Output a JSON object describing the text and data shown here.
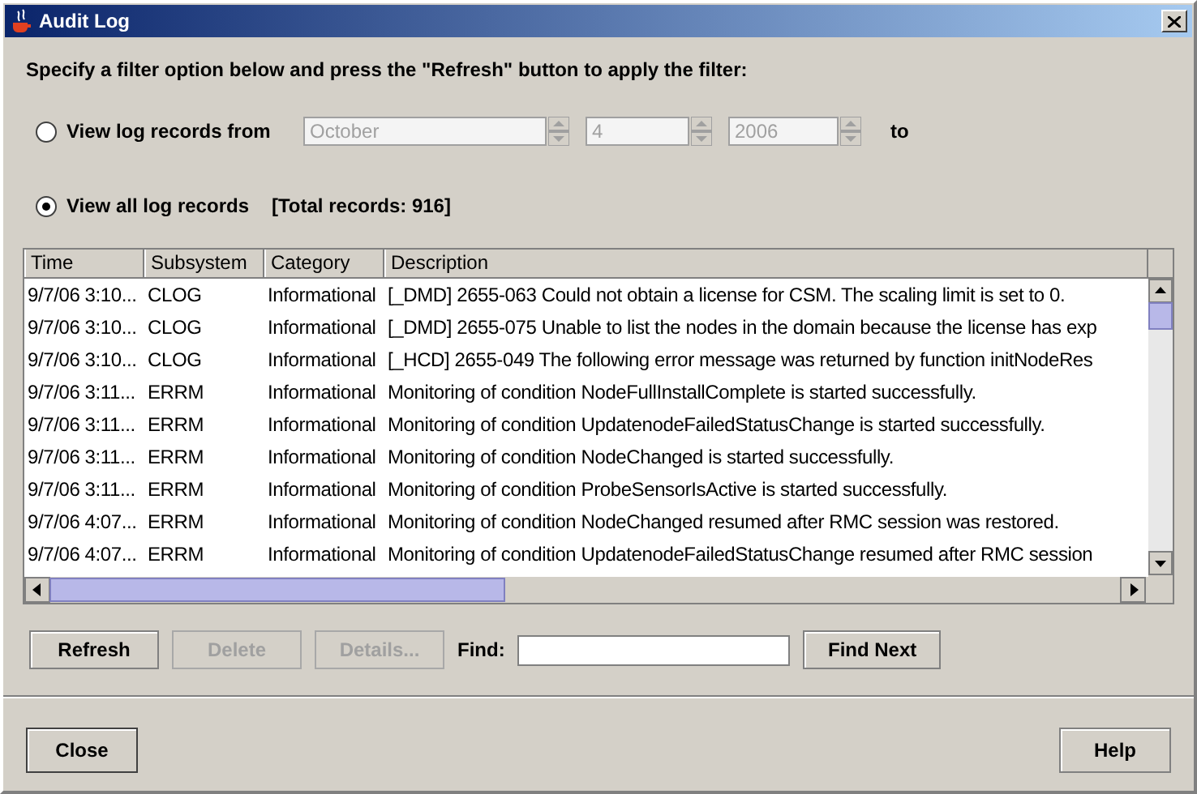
{
  "window": {
    "title": "Audit Log"
  },
  "instruction": "Specify a filter option below and press the \"Refresh\" button to apply the filter:",
  "filters": [
    {
      "label": "View log records from",
      "selected": false,
      "spinners": [
        {
          "value": "October",
          "disabled": true
        },
        {
          "value": "4",
          "disabled": true
        },
        {
          "value": "2006",
          "disabled": true
        }
      ],
      "suffix": "to"
    },
    {
      "label": "View all log records",
      "selected": true,
      "note": "[Total records: 916]"
    }
  ],
  "table": {
    "columns": [
      "Time",
      "Subsystem",
      "Category",
      "Description"
    ],
    "rows": [
      [
        "9/7/06 3:10...",
        "CLOG",
        "Informational",
        "[_DMD] 2655-063 Could not obtain a license for CSM. The scaling limit is set to 0."
      ],
      [
        "9/7/06 3:10...",
        "CLOG",
        "Informational",
        "[_DMD] 2655-075 Unable to list the nodes in the domain because the license has exp"
      ],
      [
        "9/7/06 3:10...",
        "CLOG",
        "Informational",
        "[_HCD] 2655-049 The following error message was returned by function initNodeRes"
      ],
      [
        "9/7/06 3:11...",
        "ERRM",
        "Informational",
        "Monitoring of condition NodeFullInstallComplete is started successfully."
      ],
      [
        "9/7/06 3:11...",
        "ERRM",
        "Informational",
        "Monitoring of condition UpdatenodeFailedStatusChange is started successfully."
      ],
      [
        "9/7/06 3:11...",
        "ERRM",
        "Informational",
        "Monitoring of condition NodeChanged is started successfully."
      ],
      [
        "9/7/06 3:11...",
        "ERRM",
        "Informational",
        "Monitoring of condition ProbeSensorIsActive is started successfully."
      ],
      [
        "9/7/06 4:07...",
        "ERRM",
        "Informational",
        "Monitoring of condition NodeChanged resumed after RMC session was restored."
      ],
      [
        "9/7/06 4:07...",
        "ERRM",
        "Informational",
        "Monitoring of condition UpdatenodeFailedStatusChange resumed after RMC session"
      ]
    ]
  },
  "actions": [
    {
      "label": "Refresh",
      "disabled": false
    },
    {
      "label": "Delete",
      "disabled": true
    },
    {
      "label": "Details...",
      "disabled": true
    }
  ],
  "find": {
    "label": "Find:",
    "button": "Find Next"
  },
  "footer": {
    "left": "Close",
    "right": "Help"
  }
}
